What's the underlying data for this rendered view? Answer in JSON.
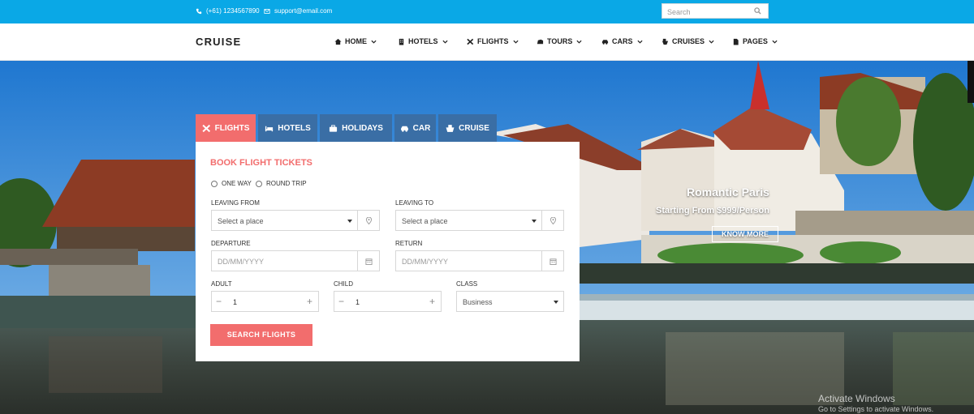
{
  "topbar": {
    "phone": "(+61) 1234567890",
    "email": "support@email.com",
    "search_placeholder": "Search"
  },
  "nav": {
    "brand": "CRUISE",
    "items": [
      {
        "label": "HOME",
        "icon": "home-icon"
      },
      {
        "label": "HOTELS",
        "icon": "building-icon"
      },
      {
        "label": "FLIGHTS",
        "icon": "plane-icon"
      },
      {
        "label": "TOURS",
        "icon": "tour-icon"
      },
      {
        "label": "CARS",
        "icon": "car-icon"
      },
      {
        "label": "CRUISES",
        "icon": "ship-icon"
      },
      {
        "label": "PAGES",
        "icon": "page-icon"
      }
    ]
  },
  "booking": {
    "tabs": [
      {
        "label": "FLIGHTS",
        "icon": "plane-icon"
      },
      {
        "label": "HOTELS",
        "icon": "bed-icon"
      },
      {
        "label": "HOLIDAYS",
        "icon": "suitcase-icon"
      },
      {
        "label": "CAR",
        "icon": "car-icon"
      },
      {
        "label": "CRUISE",
        "icon": "ship-icon"
      }
    ],
    "title": "BOOK FLIGHT TICKETS",
    "trip_one_way": "ONE WAY",
    "trip_round": "ROUND TRIP",
    "leaving_from_label": "LEAVING FROM",
    "leaving_from_value": "Select a place",
    "leaving_to_label": "LEAVING TO",
    "leaving_to_value": "Select a place",
    "departure_label": "DEPARTURE",
    "departure_placeholder": "DD/MM/YYYY",
    "return_label": "RETURN",
    "return_placeholder": "DD/MM/YYYY",
    "adult_label": "ADULT",
    "adult_value": "1",
    "child_label": "CHILD",
    "child_value": "1",
    "class_label": "CLASS",
    "class_value": "Business",
    "submit_label": "SEARCH FLIGHTS"
  },
  "slide": {
    "title": "Romantic Paris",
    "subtitle": "Starting From $999/Person",
    "button": "KNOW MORE"
  },
  "watermark": {
    "line1": "Activate Windows",
    "line2": "Go to Settings to activate Windows."
  },
  "colors": {
    "topbar": "#0aa8e6",
    "accent": "#f26d6d",
    "tab": "#3a6ea5"
  }
}
